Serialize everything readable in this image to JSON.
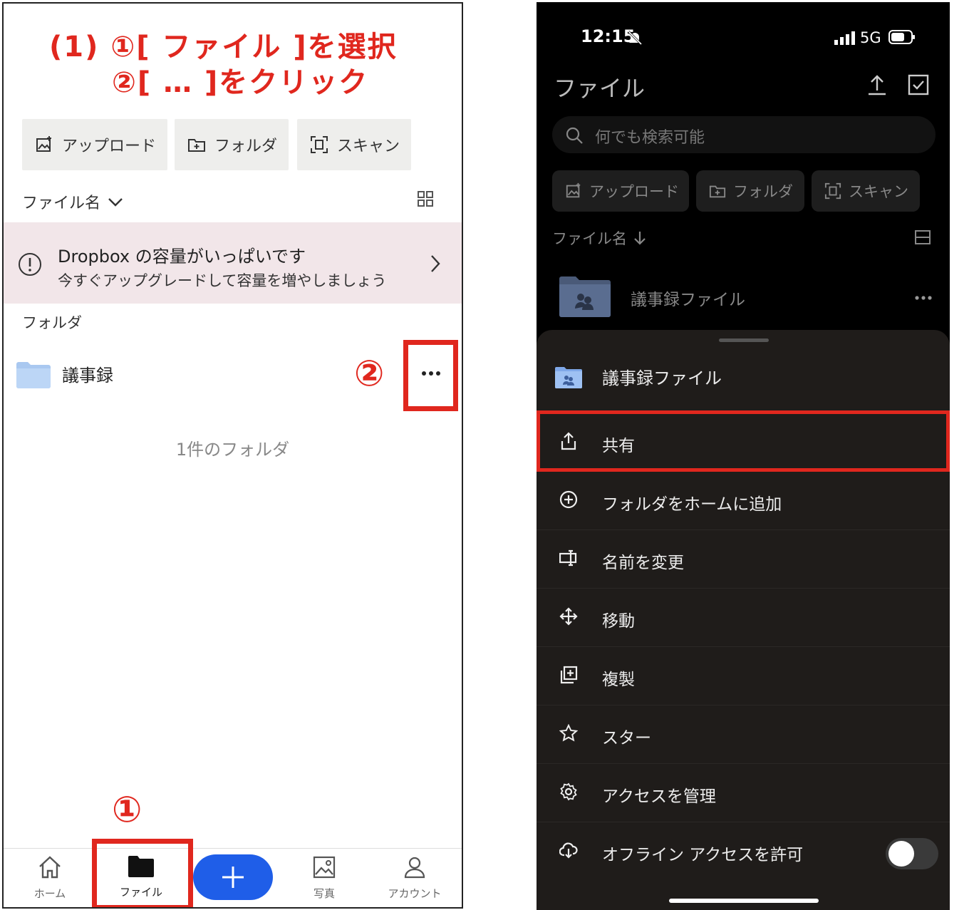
{
  "left": {
    "instructions": {
      "line1": "(1) ①[ ファイル ]を選択",
      "line2": "②[ … ]をクリック"
    },
    "buttons": {
      "upload": "アップロード",
      "folder": "フォルダ",
      "scan": "スキャン"
    },
    "sort_label": "ファイル名",
    "banner": {
      "title": "Dropbox の容量がいっぱいです",
      "subtitle": "今すぐアップグレードして容量を増やしましょう"
    },
    "section_folder": "フォルダ",
    "folder_name": "議事録",
    "folder_count": "1件のフォルダ",
    "callout_1": "①",
    "callout_2": "②",
    "tabs": {
      "home": "ホーム",
      "files": "ファイル",
      "photos": "写真",
      "account": "アカウント"
    },
    "accent_color": "#e0271e",
    "fab_color": "#1f5ee8"
  },
  "right": {
    "status": {
      "time": "12:15",
      "network": "5G"
    },
    "title": "ファイル",
    "search_placeholder": "何でも検索可能",
    "buttons": {
      "upload": "アップロード",
      "folder": "フォルダ",
      "scan": "スキャン"
    },
    "sort_label": "ファイル名",
    "file_name": "議事録ファイル",
    "sheet": {
      "title": "議事録ファイル",
      "items": [
        {
          "label": "共有",
          "icon": "share-icon"
        },
        {
          "label": "フォルダをホームに追加",
          "icon": "add-circle-icon"
        },
        {
          "label": "名前を変更",
          "icon": "rename-icon"
        },
        {
          "label": "移動",
          "icon": "move-icon"
        },
        {
          "label": "複製",
          "icon": "duplicate-icon"
        },
        {
          "label": "スター",
          "icon": "star-icon"
        },
        {
          "label": "アクセスを管理",
          "icon": "gear-icon"
        },
        {
          "label": "オフライン アクセスを許可",
          "icon": "offline-icon"
        }
      ],
      "offline_toggle": false
    }
  }
}
